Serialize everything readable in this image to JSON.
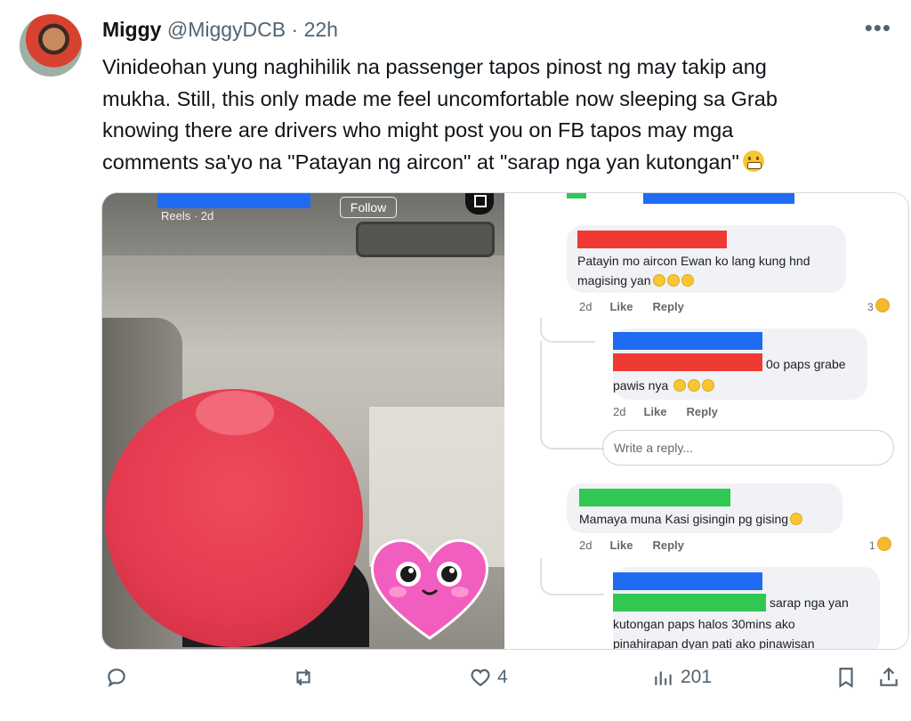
{
  "tweet": {
    "author_name": "Miggy",
    "handle": "@MiggyDCB",
    "separator": "·",
    "time": "22h",
    "more": "•••",
    "lines": [
      "Vinideohan yung naghihilik na passenger tapos pinost ng may takip ang",
      "mukha. Still, this only made me feel uncomfortable now sleeping sa Grab",
      "knowing there are drivers who might post you on FB tapos may mga",
      "comments sa'yo na \"Patayan ng aircon\" at  \"sarap nga yan kutongan\""
    ],
    "emoji": "grimacing-face"
  },
  "media": {
    "left": {
      "reels_label": "Reels · 2d",
      "follow_label": "Follow"
    },
    "comments": [
      {
        "text_lines": [
          "Patayin mo aircon Ewan ko lang kung hnd",
          "magising yan"
        ],
        "time": "2d",
        "like": "Like",
        "reply": "Reply",
        "reactions": "3"
      },
      {
        "text_lines": [
          "0o paps grabe",
          "pawis nya"
        ],
        "time": "2d",
        "like": "Like",
        "reply": "Reply"
      },
      {
        "reply_placeholder": "Write a reply..."
      },
      {
        "text_lines": [
          "Mamaya muna Kasi gisingin pg gising"
        ],
        "time": "2d",
        "like": "Like",
        "reply": "Reply",
        "reactions": "1"
      },
      {
        "text_lines": [
          "sarap nga yan",
          "kutongan paps halos 30mins ako",
          "pinahirapan dyan pati ako pinawisan"
        ]
      }
    ]
  },
  "actions": {
    "reply_count": "",
    "retweet_count": "",
    "like_count": "4",
    "views_count": "201"
  },
  "colors": {
    "censor_blue": "#1f6cf2",
    "censor_red": "#ef3a33",
    "censor_green": "#30c852",
    "face_cover": "#e33a4f"
  }
}
